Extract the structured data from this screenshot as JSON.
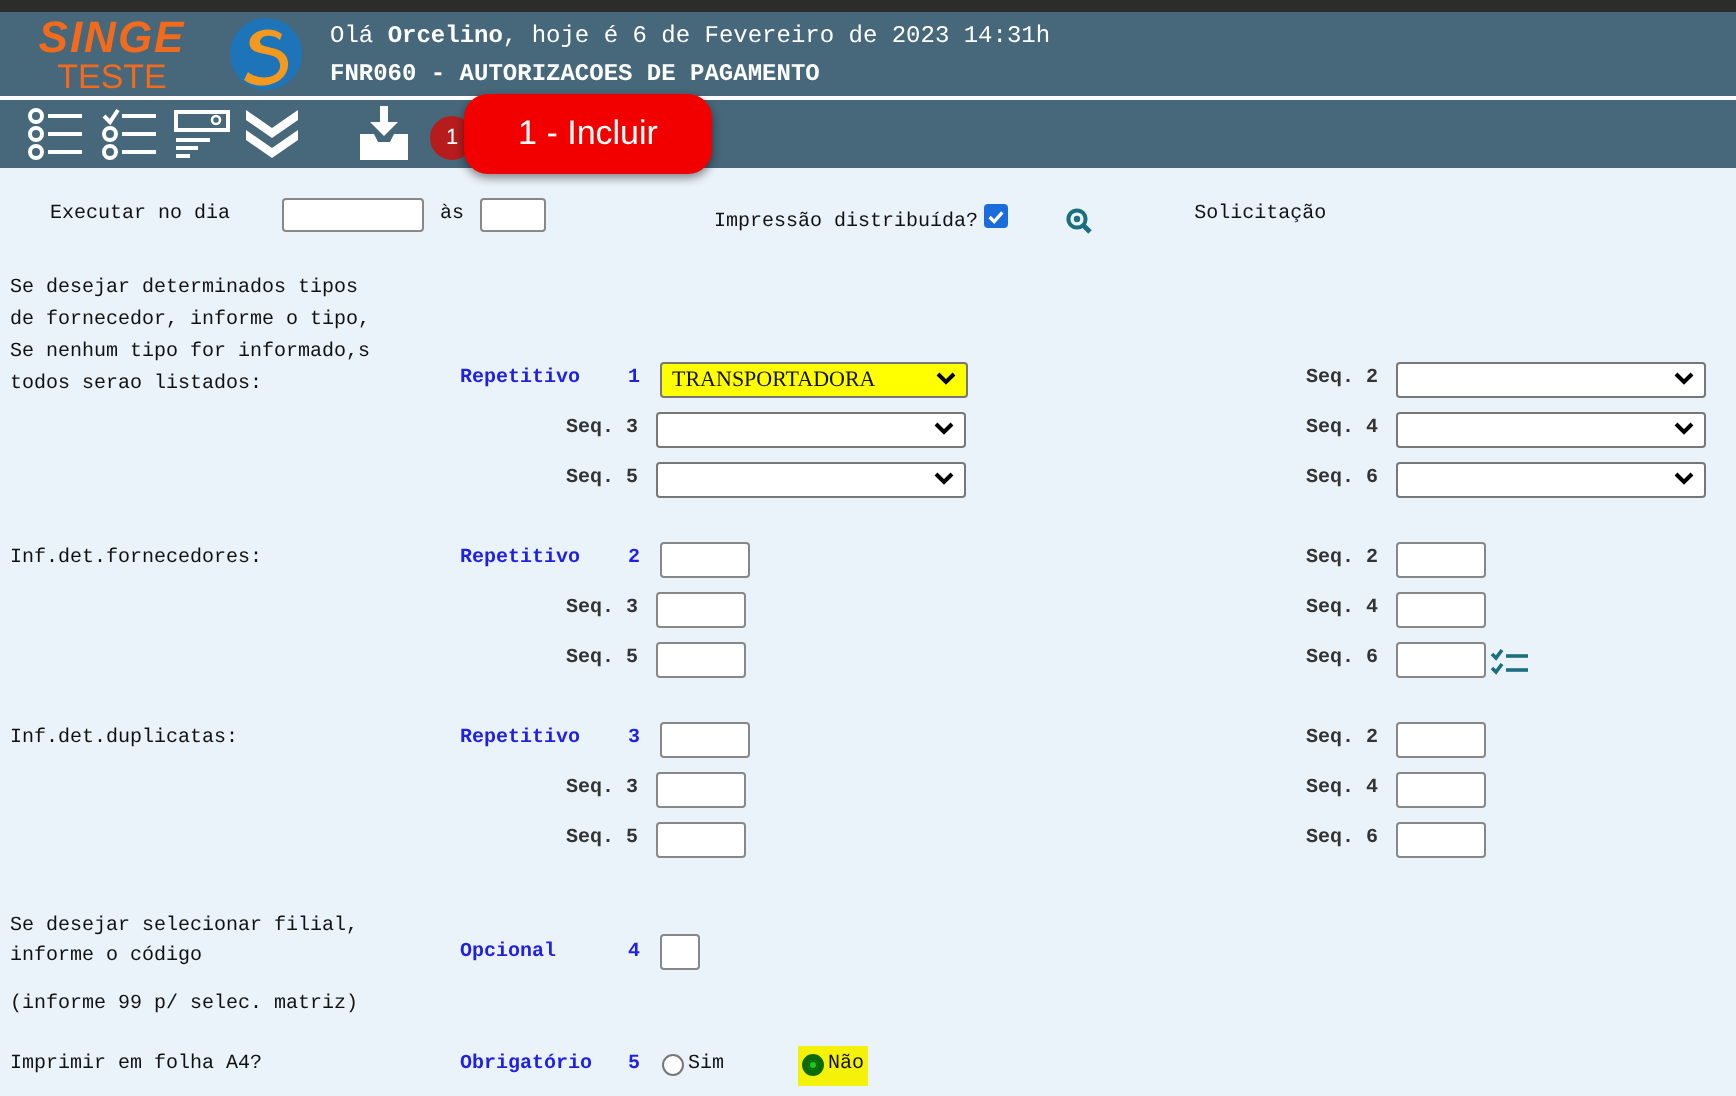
{
  "header": {
    "logo_top": "SINGE",
    "logo_bottom": "TESTE",
    "greeting": "Olá **Orcelino**, hoje é 6 de Fevereiro de 2023 14:31h",
    "title": "FNR060 - AUTORIZACOES DE PAGAMENTO"
  },
  "toolbar": {
    "badge": "1",
    "tooltip": "1 - Incluir"
  },
  "top": {
    "execute_label": "Executar no dia",
    "at_label": "às",
    "print_label": "Impressão distribuída?",
    "print_checked": true,
    "request_label": "Solicitação"
  },
  "sections": [
    {
      "kind": "select",
      "description": "Se desejar determinados tipos de fornecedor, informe o tipo, Se nenhum tipo for informado,s todos serao listados:",
      "tag": "Repetitivo",
      "number": "1",
      "main": {
        "value": "TRANSPORTADORA",
        "highlighted": true
      },
      "fields": [
        {
          "label": "Seq. 2"
        },
        {
          "label": "Seq. 3"
        },
        {
          "label": "Seq. 4"
        },
        {
          "label": "Seq. 5"
        },
        {
          "label": "Seq. 6"
        }
      ]
    },
    {
      "kind": "text",
      "description": "Inf.det.fornecedores:",
      "tag": "Repetitivo",
      "number": "2",
      "main": {
        "highlighted": false
      },
      "fields": [
        {
          "label": "Seq. 2"
        },
        {
          "label": "Seq. 3"
        },
        {
          "label": "Seq. 4"
        },
        {
          "label": "Seq. 5"
        },
        {
          "label": "Seq. 6",
          "icon": true
        }
      ]
    },
    {
      "kind": "text",
      "description": "Inf.det.duplicatas:",
      "tag": "Repetitivo",
      "number": "3",
      "main": {
        "highlighted": false
      },
      "fields": [
        {
          "label": "Seq. 2"
        },
        {
          "label": "Seq. 3"
        },
        {
          "label": "Seq. 4"
        },
        {
          "label": "Seq. 5"
        },
        {
          "label": "Seq. 6"
        }
      ]
    },
    {
      "kind": "code",
      "description": "Se desejar selecionar filial, informe o código",
      "note": "(informe 99 p/ selec. matriz)",
      "tag": "Opcional",
      "number": "4"
    },
    {
      "kind": "radio",
      "description": "Imprimir em folha A4?",
      "tag": "Obrigatório",
      "number": "5",
      "options": [
        {
          "label": "Sim",
          "selected": false
        },
        {
          "label": "Não",
          "selected": true
        }
      ]
    }
  ]
}
